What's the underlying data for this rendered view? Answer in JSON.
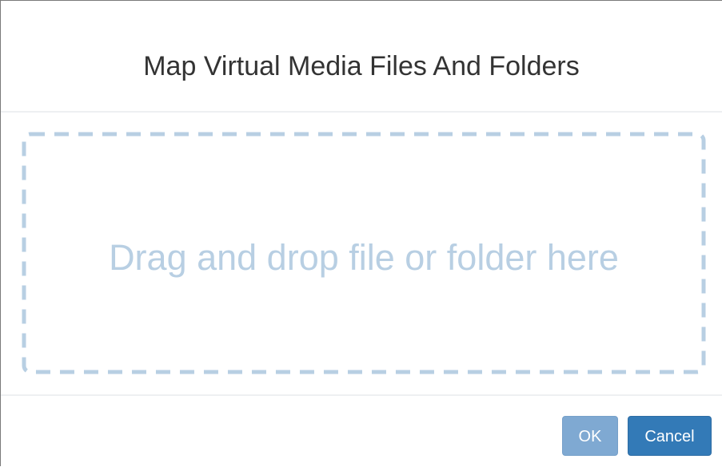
{
  "dialog": {
    "title": "Map Virtual Media Files And Folders",
    "drop_zone_text": "Drag and drop file or folder here",
    "buttons": {
      "ok_label": "OK",
      "cancel_label": "Cancel"
    },
    "colors": {
      "title_text": "#333333",
      "drop_zone_border": "#b8cfe3",
      "drop_zone_text": "#b8cfe3",
      "ok_button_disabled": "#7fa9d2",
      "cancel_button": "#337ab7"
    }
  }
}
